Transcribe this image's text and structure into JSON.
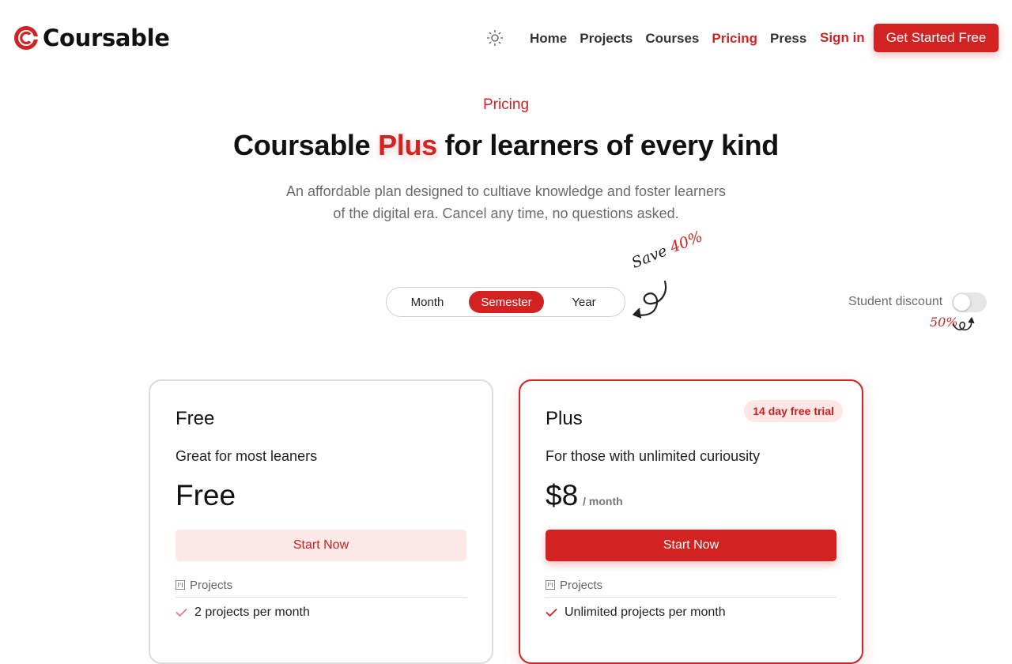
{
  "brand": {
    "name": "Coursable",
    "accent": "#d32222"
  },
  "nav": {
    "items": [
      {
        "label": "Home",
        "active": false
      },
      {
        "label": "Projects",
        "active": false
      },
      {
        "label": "Courses",
        "active": false
      },
      {
        "label": "Pricing",
        "active": true
      },
      {
        "label": "Press",
        "active": false
      }
    ],
    "sign_in": "Sign in",
    "cta": "Get Started Free",
    "theme_icon": "sun-icon"
  },
  "hero": {
    "eyebrow": "Pricing",
    "headline_pre": "Coursable ",
    "headline_accent": "Plus",
    "headline_post": " for learners of every kind",
    "subtitle": "An affordable plan designed to cultiave knowledge and foster learners of the digital era. Cancel any time, no questions asked."
  },
  "billing": {
    "options": [
      "Month",
      "Semester",
      "Year"
    ],
    "selected": "Semester",
    "save_word": "Save",
    "save_percent": "40%"
  },
  "student": {
    "label": "Student discount",
    "enabled": false,
    "note": "50%"
  },
  "plans": [
    {
      "name": "Free",
      "description": "Great for most leaners",
      "price": "Free",
      "period": "",
      "button": "Start Now",
      "feature_heading": "Projects",
      "features": [
        "2 projects per month"
      ]
    },
    {
      "name": "Plus",
      "badge": "14 day free trial",
      "description": "For those with unlimited curiousity",
      "price": "$8",
      "period": "/ month",
      "button": "Start Now",
      "feature_heading": "Projects",
      "features": [
        "Unlimited projects per month"
      ]
    }
  ]
}
